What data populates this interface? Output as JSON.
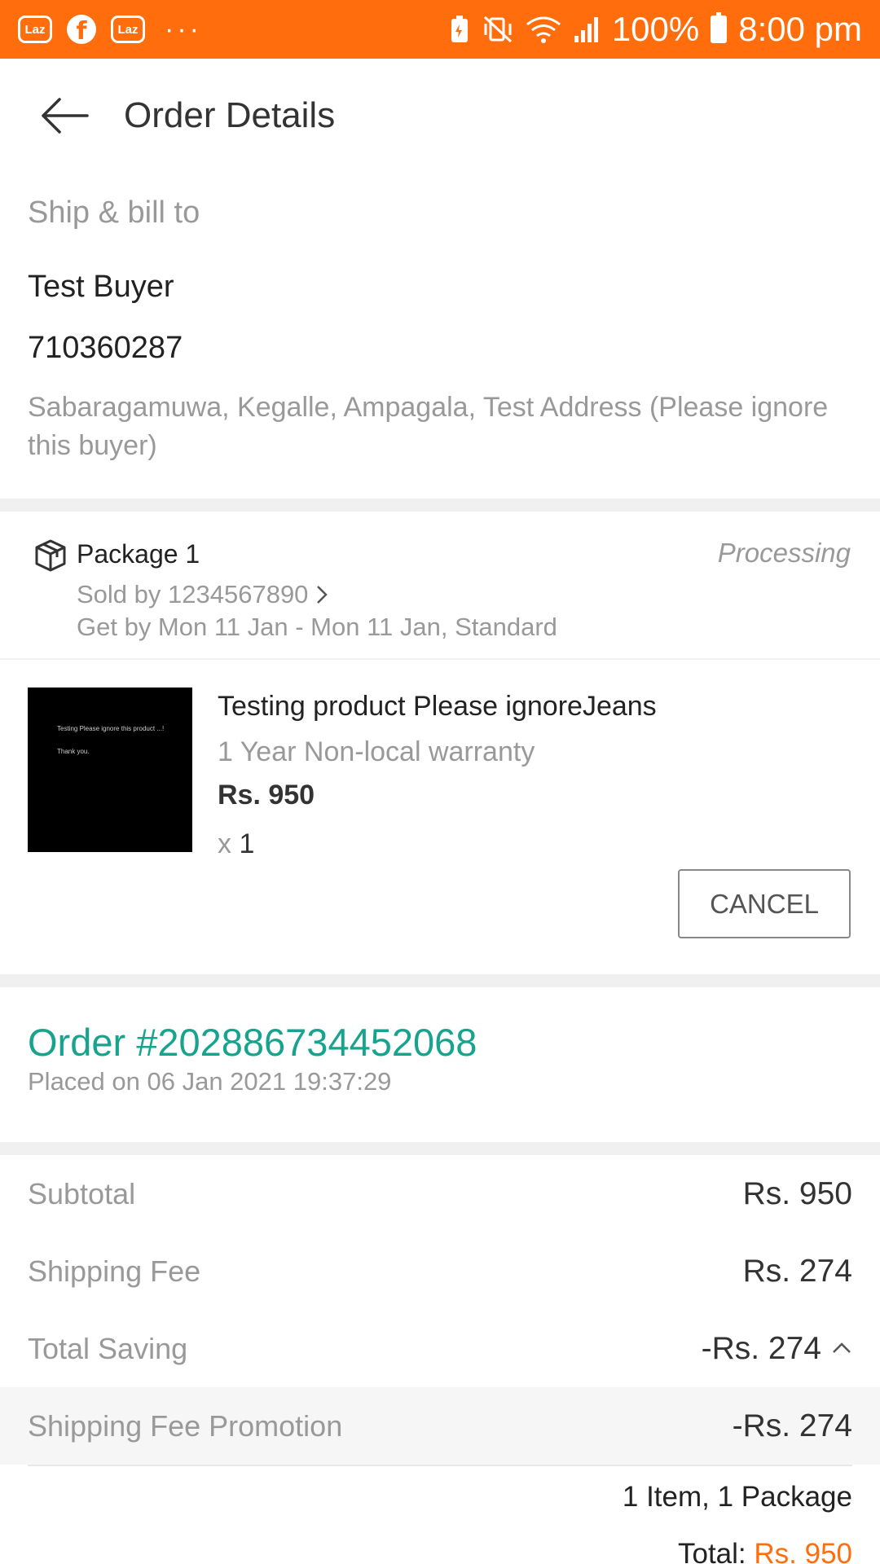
{
  "status_bar": {
    "app_icon_1": "Laz",
    "app_icon_3": "Laz",
    "overflow": "···",
    "battery_percent": "100%",
    "time": "8:00 pm"
  },
  "header": {
    "title": "Order Details"
  },
  "address": {
    "heading": "Ship & bill to",
    "name": "Test Buyer",
    "phone": "710360287",
    "line": "Sabaragamuwa, Kegalle, Ampagala, Test Address (Please ignore this buyer)"
  },
  "package": {
    "title": "Package 1",
    "status": "Processing",
    "seller": "Sold by 1234567890",
    "delivery": "Get by Mon 11 Jan - Mon 11 Jan, Standard"
  },
  "product": {
    "image_text_1": "Testing Please ignore this product ...!",
    "image_text_2": "Thank you.",
    "name": "Testing product Please ignoreJeans",
    "warranty": "1 Year Non-local warranty",
    "price": "Rs. 950",
    "qty_prefix": "x",
    "qty": "1",
    "cancel_label": "CANCEL"
  },
  "order": {
    "number": "Order #202886734452068",
    "placed": "Placed on 06 Jan 2021  19:37:29"
  },
  "summary": {
    "subtotal_label": "Subtotal",
    "subtotal_value": "Rs. 950",
    "shipping_label": "Shipping Fee",
    "shipping_value": "Rs. 274",
    "saving_label": "Total Saving",
    "saving_value": "-Rs. 274",
    "promo_label": "Shipping Fee Promotion",
    "promo_value": "-Rs. 274",
    "count": "1 Item, 1 Package",
    "total_label": "Total:",
    "total_value": "Rs. 950"
  },
  "colors": {
    "brand_orange": "#ff6d0d",
    "order_green": "#17a38d"
  }
}
